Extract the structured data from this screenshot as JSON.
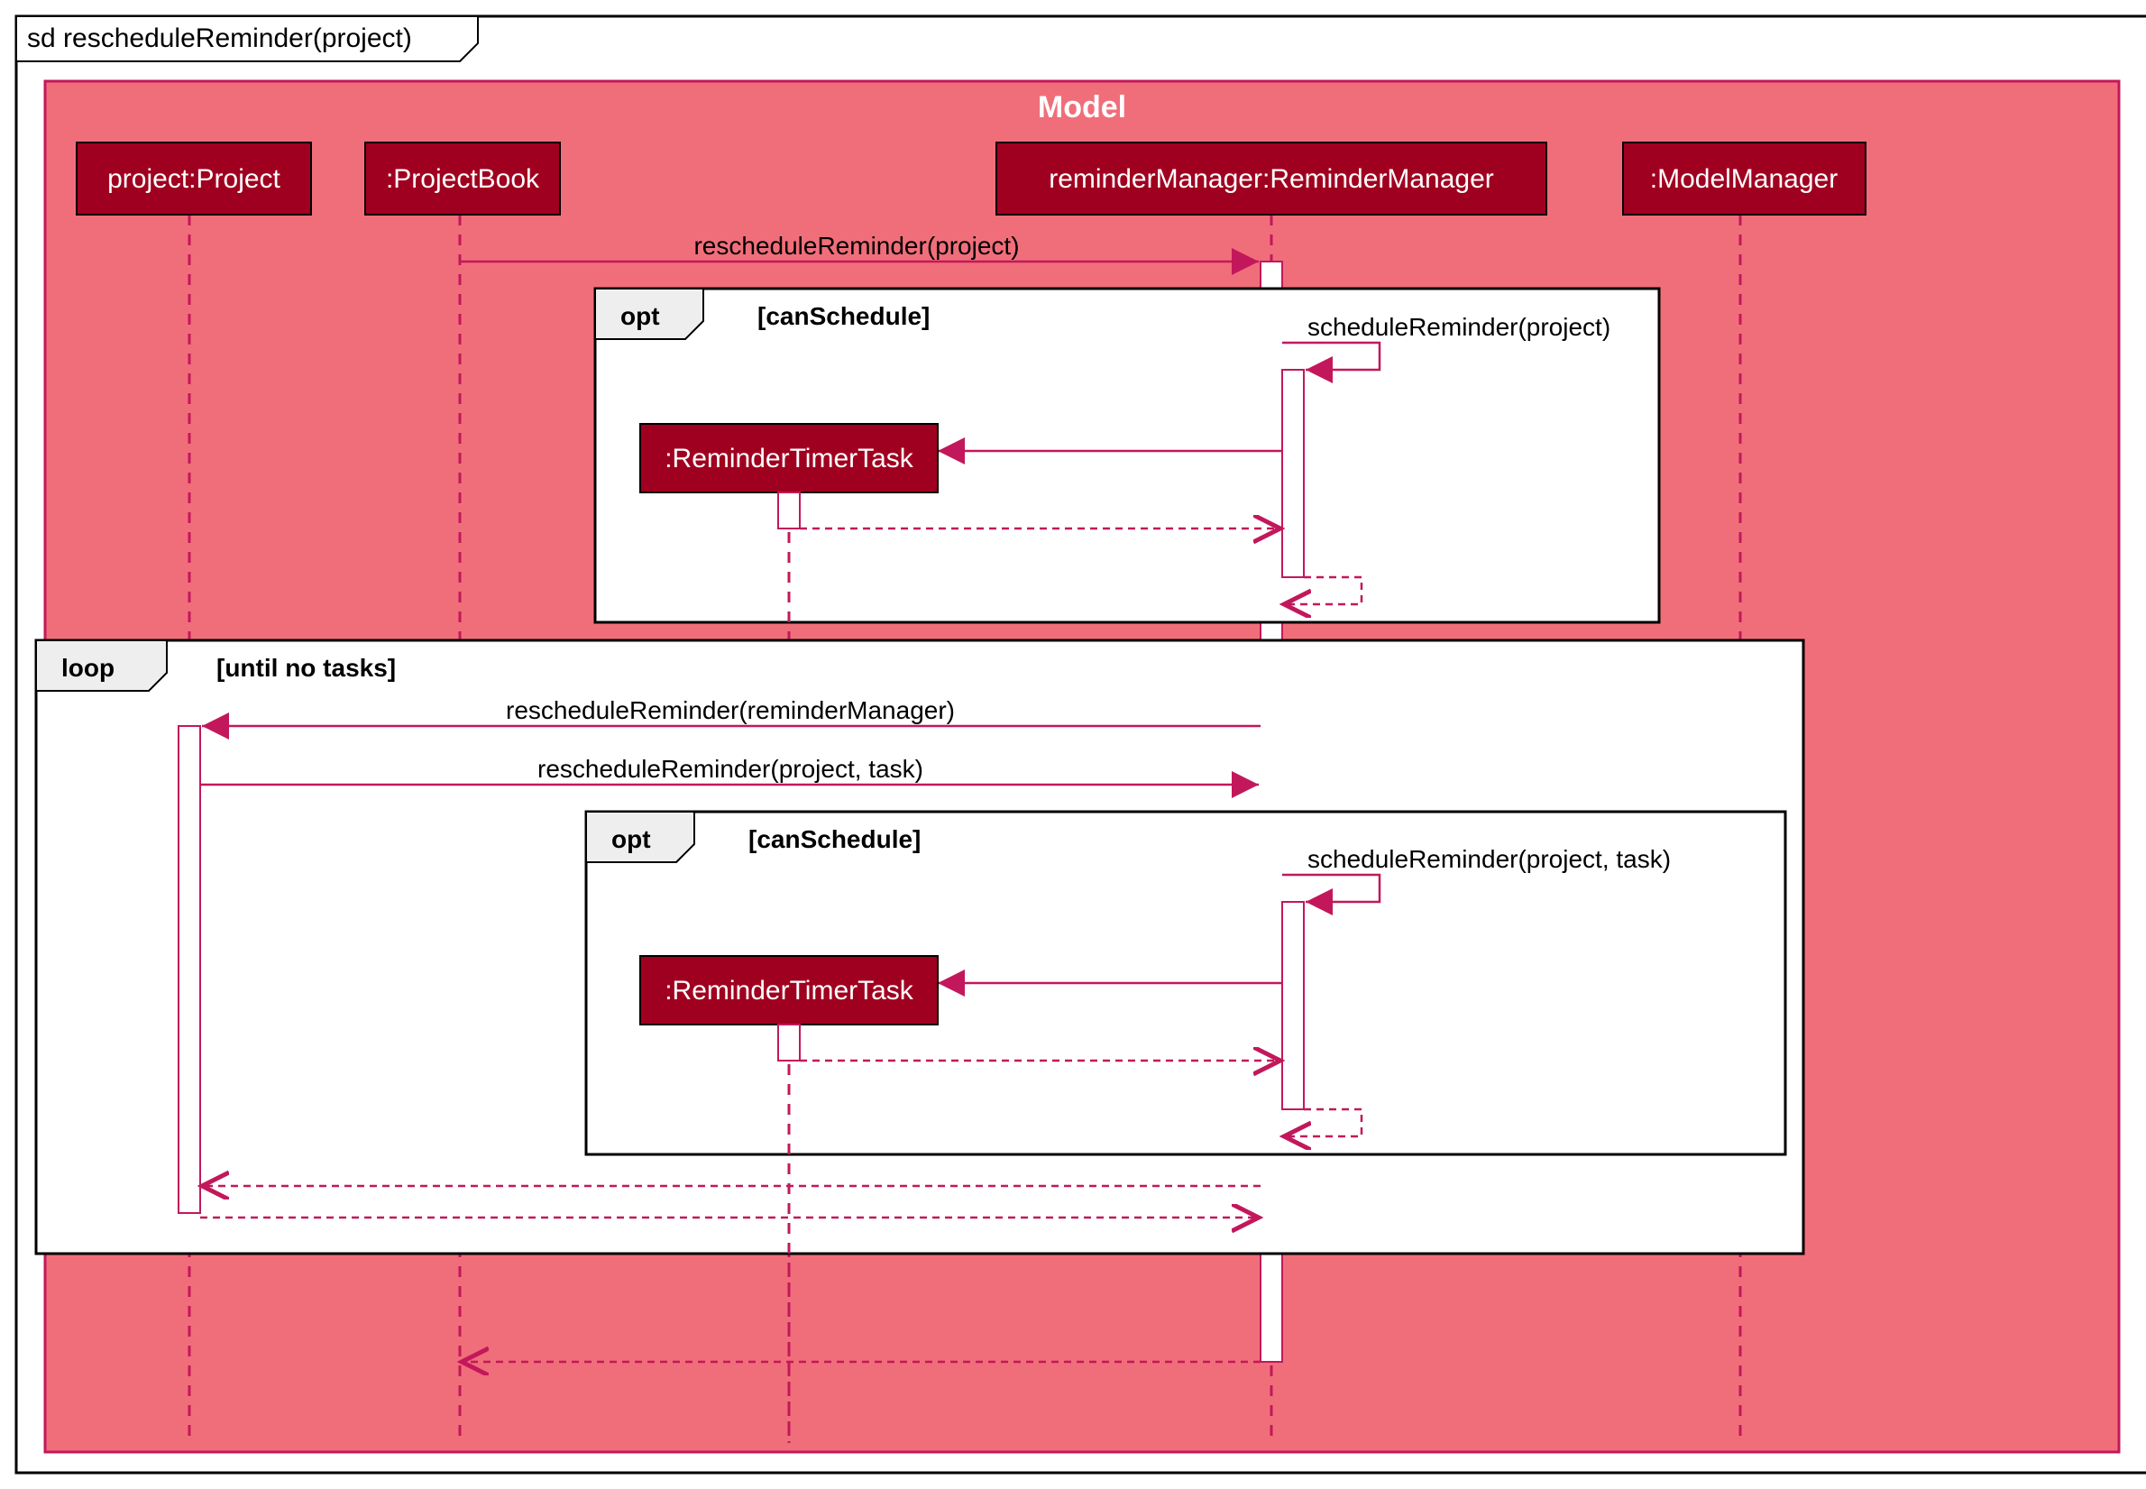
{
  "frame": {
    "title": "sd rescheduleReminder(project)"
  },
  "model": {
    "title": "Model"
  },
  "lifelines": {
    "project": "project:Project",
    "projectBook": ":ProjectBook",
    "reminderManager": "reminderManager:ReminderManager",
    "modelManager": ":ModelManager",
    "reminderTimerTask1": ":ReminderTimerTask",
    "reminderTimerTask2": ":ReminderTimerTask"
  },
  "fragments": {
    "opt1": {
      "type": "opt",
      "guard": "[canSchedule]"
    },
    "loop": {
      "type": "loop",
      "guard": "[until no tasks]"
    },
    "opt2": {
      "type": "opt",
      "guard": "[canSchedule]"
    }
  },
  "messages": {
    "m1": "rescheduleReminder(project)",
    "m2": "scheduleReminder(project)",
    "m3": "rescheduleReminder(reminderManager)",
    "m4": "rescheduleReminder(project, task)",
    "m5": "scheduleReminder(project, task)"
  }
}
